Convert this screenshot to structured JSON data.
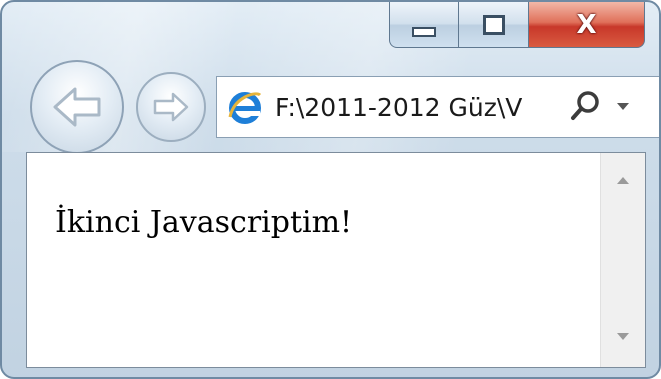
{
  "window": {
    "caption_buttons": {
      "minimize_icon": "minimize-icon",
      "maximize_icon": "maximize-icon",
      "close_label": "X"
    }
  },
  "navigation": {
    "back_icon": "back-arrow-icon",
    "forward_icon": "forward-arrow-icon"
  },
  "address_bar": {
    "favicon": "internet-explorer-icon",
    "url": "F:\\2011-2012 Güz\\V",
    "search_icon": "search-icon",
    "dropdown_icon": "chevron-down-icon"
  },
  "page": {
    "body_text": "İkinci Javascriptim!"
  },
  "colors": {
    "close_button": "#c8382a",
    "frame": "#bccfe1",
    "ie_logo": "#1e7fd8"
  }
}
